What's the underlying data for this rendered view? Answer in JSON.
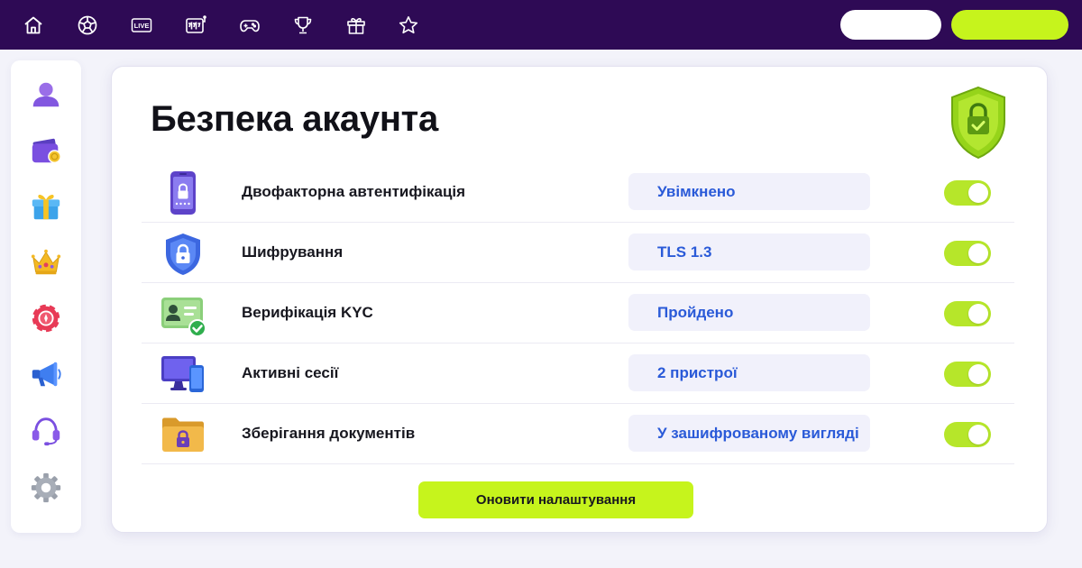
{
  "colors": {
    "topbar": "#2e0a55",
    "accent_lime": "#c6f41c",
    "value_text": "#2a5ad8",
    "page_bg": "#f3f3fa"
  },
  "topnav": {
    "icons": [
      "home-icon",
      "soccer-ball-icon",
      "live-icon",
      "slot-machine-icon",
      "gamepad-icon",
      "trophy-icon",
      "gift-icon",
      "star-icon"
    ],
    "live_text": "LIVE",
    "button_white_label": "",
    "button_lime_label": ""
  },
  "sidebar": {
    "icons": [
      "user-icon",
      "wallet-icon",
      "gift-icon",
      "crown-icon",
      "casino-chip-icon",
      "megaphone-icon",
      "headset-icon",
      "gear-icon"
    ]
  },
  "main": {
    "title": "Безпека акаунта",
    "badge_icon": "shield-lock-icon",
    "rows": [
      {
        "icon": "phone-lock-icon",
        "label": "Двофакторна автентифікація",
        "value": "Увімкнено",
        "enabled": true
      },
      {
        "icon": "shield-lock-icon",
        "label": "Шифрування",
        "value": "TLS 1.3",
        "enabled": true
      },
      {
        "icon": "id-card-check-icon",
        "label": "Верифікація KYC",
        "value": "Пройдено",
        "enabled": true
      },
      {
        "icon": "devices-icon",
        "label": "Активні сесії",
        "value": "2 пристрої",
        "enabled": true
      },
      {
        "icon": "folder-lock-icon",
        "label": "Зберігання документів",
        "value": "У зашифрованому вигляді",
        "enabled": true
      }
    ],
    "update_button": "Оновити налаштування"
  }
}
